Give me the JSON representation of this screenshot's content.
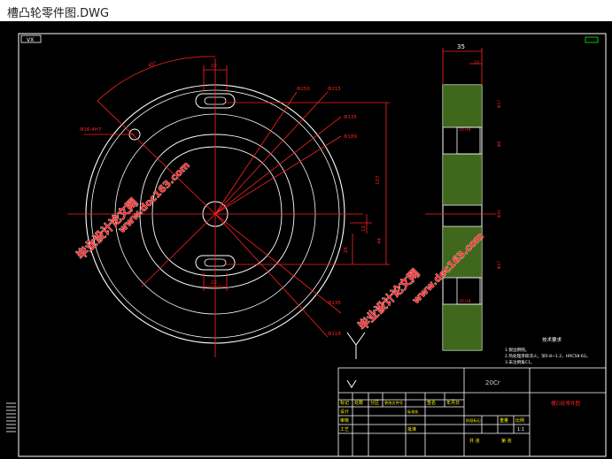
{
  "window": {
    "title": "槽凸轮零件图.DWG"
  },
  "drawing": {
    "corner_tag": "VX",
    "dimensions": {
      "top_width": "35",
      "top_offset": "10",
      "slot_width": "22",
      "slot_width_bottom": "22",
      "d250": "Φ250",
      "d215": "Φ215",
      "d135_top": "Φ135",
      "d189": "Φ189",
      "hole_small": "Φ16-4H7",
      "angle": "45°",
      "h107": "107",
      "h12": "12",
      "h44": "44",
      "h26": "26",
      "d135_bottom": "Φ135",
      "d118": "Φ118",
      "side_a": "Φ17",
      "side_b": "20 H8",
      "side_c": "Φ8",
      "side_d": "Φ50",
      "side_e": "20 H8",
      "side_f": "Φ17"
    },
    "notes": {
      "heading": "技术要求",
      "line1": "1.锐边倒钝。",
      "line2": "2.热处理渗碳淬火，深0.8~1.2，HRC58-62。",
      "line3": "3.未注倒角C1。"
    },
    "watermarks": [
      {
        "cn": "毕业设计论文网",
        "url": "www.doc163.com"
      },
      {
        "cn": "毕业设计论文网",
        "url": "www.doc163.com"
      }
    ],
    "title_block": {
      "material": "20Cr",
      "part_name": "槽凸轮零件图",
      "header_cells": [
        "标记",
        "处数",
        "分区",
        "更改文件号",
        "签名",
        "年月日"
      ],
      "rows": [
        [
          "设计",
          "",
          "标准化",
          ""
        ],
        [
          "审核",
          "",
          "",
          ""
        ],
        [
          "工艺",
          "",
          "批准",
          ""
        ]
      ],
      "stage_cells": [
        "阶段标记",
        "重量",
        "比例"
      ],
      "scale": "1:1",
      "sheet": [
        "共 张",
        "第 张"
      ]
    }
  }
}
